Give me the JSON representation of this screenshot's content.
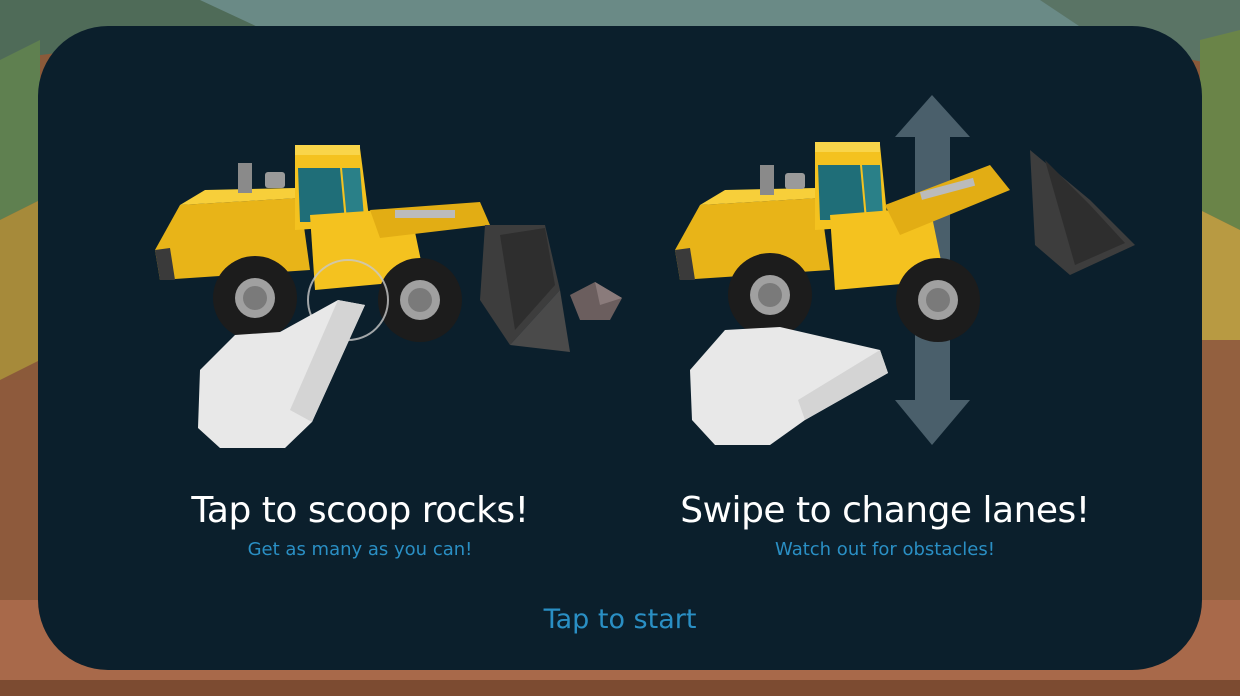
{
  "tutorial": {
    "left": {
      "title": "Tap to scoop rocks!",
      "subtitle": "Get as many as you can!"
    },
    "right": {
      "title": "Swipe to change lanes!",
      "subtitle": "Watch out for obstacles!"
    },
    "start_label": "Tap to start"
  },
  "colors": {
    "panel": "#0b1f2c",
    "accent": "#2a8fc4",
    "loader_yellow": "#f4c21f",
    "bucket": "#3a3a3a",
    "hand": "#e8e8e8",
    "arrow": "#4a5f6b"
  },
  "icons": [
    "wheel-loader-icon",
    "rock-icon",
    "tap-hand-icon",
    "swipe-hand-icon",
    "vertical-arrow-icon"
  ]
}
